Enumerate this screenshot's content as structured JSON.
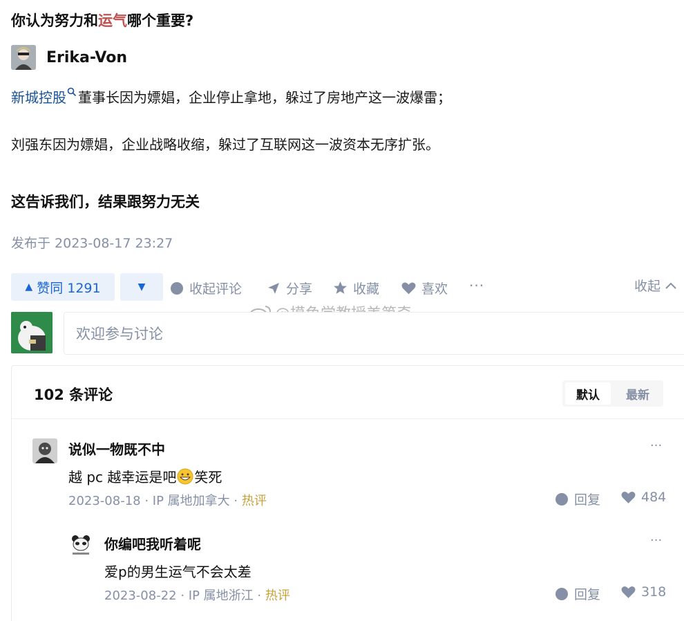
{
  "question": {
    "title_part1": "你认为努力和",
    "title_highlight": "运气",
    "title_part2": "哪个重要?"
  },
  "answer": {
    "author": "Erika-Von",
    "line1_link": "新城控股",
    "line1_rest": "董事长因为嫖娼，企业停止拿地，躲过了房地产这一波爆雷；",
    "line2": "刘强东因为嫖娼，企业战略收缩，躲过了互联网这一波资本无序扩张。",
    "line3": "这告诉我们，结果跟努力无关",
    "publish_time": "发布于 2023-08-17 23:27"
  },
  "actions": {
    "upvote_label": "赞同 1291",
    "collapse_comments": "收起评论",
    "share": "分享",
    "favorite": "收藏",
    "like": "喜欢",
    "more": "···",
    "collapse": "收起"
  },
  "watermark": "@摸鱼学教授美第奇",
  "comment_input": {
    "placeholder": "欢迎参与讨论"
  },
  "comments_section": {
    "count_label": "102 条评论",
    "sort_default": "默认",
    "sort_latest": "最新",
    "items": [
      {
        "name": "说似一物既不中",
        "text_before": "越 pc 越幸运是吧",
        "text_after": "笑死",
        "date": "2023-08-18",
        "location": "IP 属地加拿大",
        "hot": "热评",
        "reply": "回复",
        "likes": "484",
        "more": "···"
      },
      {
        "name": "你编吧我听着呢",
        "text": "爱p的男生运气不会太差",
        "date": "2023-08-22",
        "location": "IP 属地浙江",
        "hot": "热评",
        "reply": "回复",
        "likes": "318",
        "more": "···"
      }
    ]
  },
  "colors": {
    "link": "#175199",
    "highlight": "#c0504d",
    "vote_blue": "#1a66d6",
    "muted": "#8590a6",
    "hot": "#c9a23b"
  }
}
